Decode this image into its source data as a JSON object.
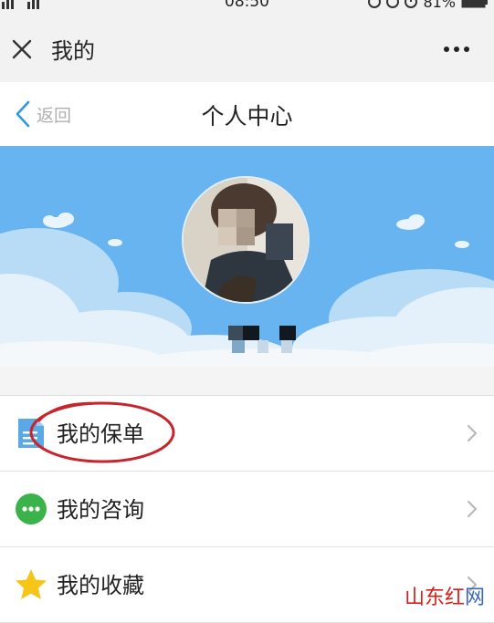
{
  "status_bar": {
    "time": "08:50",
    "battery": "81%"
  },
  "title_bar": {
    "title": "我的",
    "icons": [
      "close-icon",
      "more-icon"
    ]
  },
  "nav_bar": {
    "back_label": "返回",
    "title": "个人中心"
  },
  "profile": {
    "avatar_icon": "avatar-photo"
  },
  "menu": {
    "items": [
      {
        "label": "我的保单",
        "icon": "document-icon",
        "icon_color": "#5aa8e6"
      },
      {
        "label": "我的咨询",
        "icon": "chat-bubble-icon",
        "icon_color": "#3cb34a"
      },
      {
        "label": "我的收藏",
        "icon": "star-icon",
        "icon_color": "#f5c518"
      }
    ]
  },
  "watermark": {
    "text_main": "山东红",
    "text_accent": "网"
  },
  "colors": {
    "banner_sky": "#67b4f0",
    "highlight_circle": "#c7242c",
    "back_accent": "#2f9ae0"
  }
}
